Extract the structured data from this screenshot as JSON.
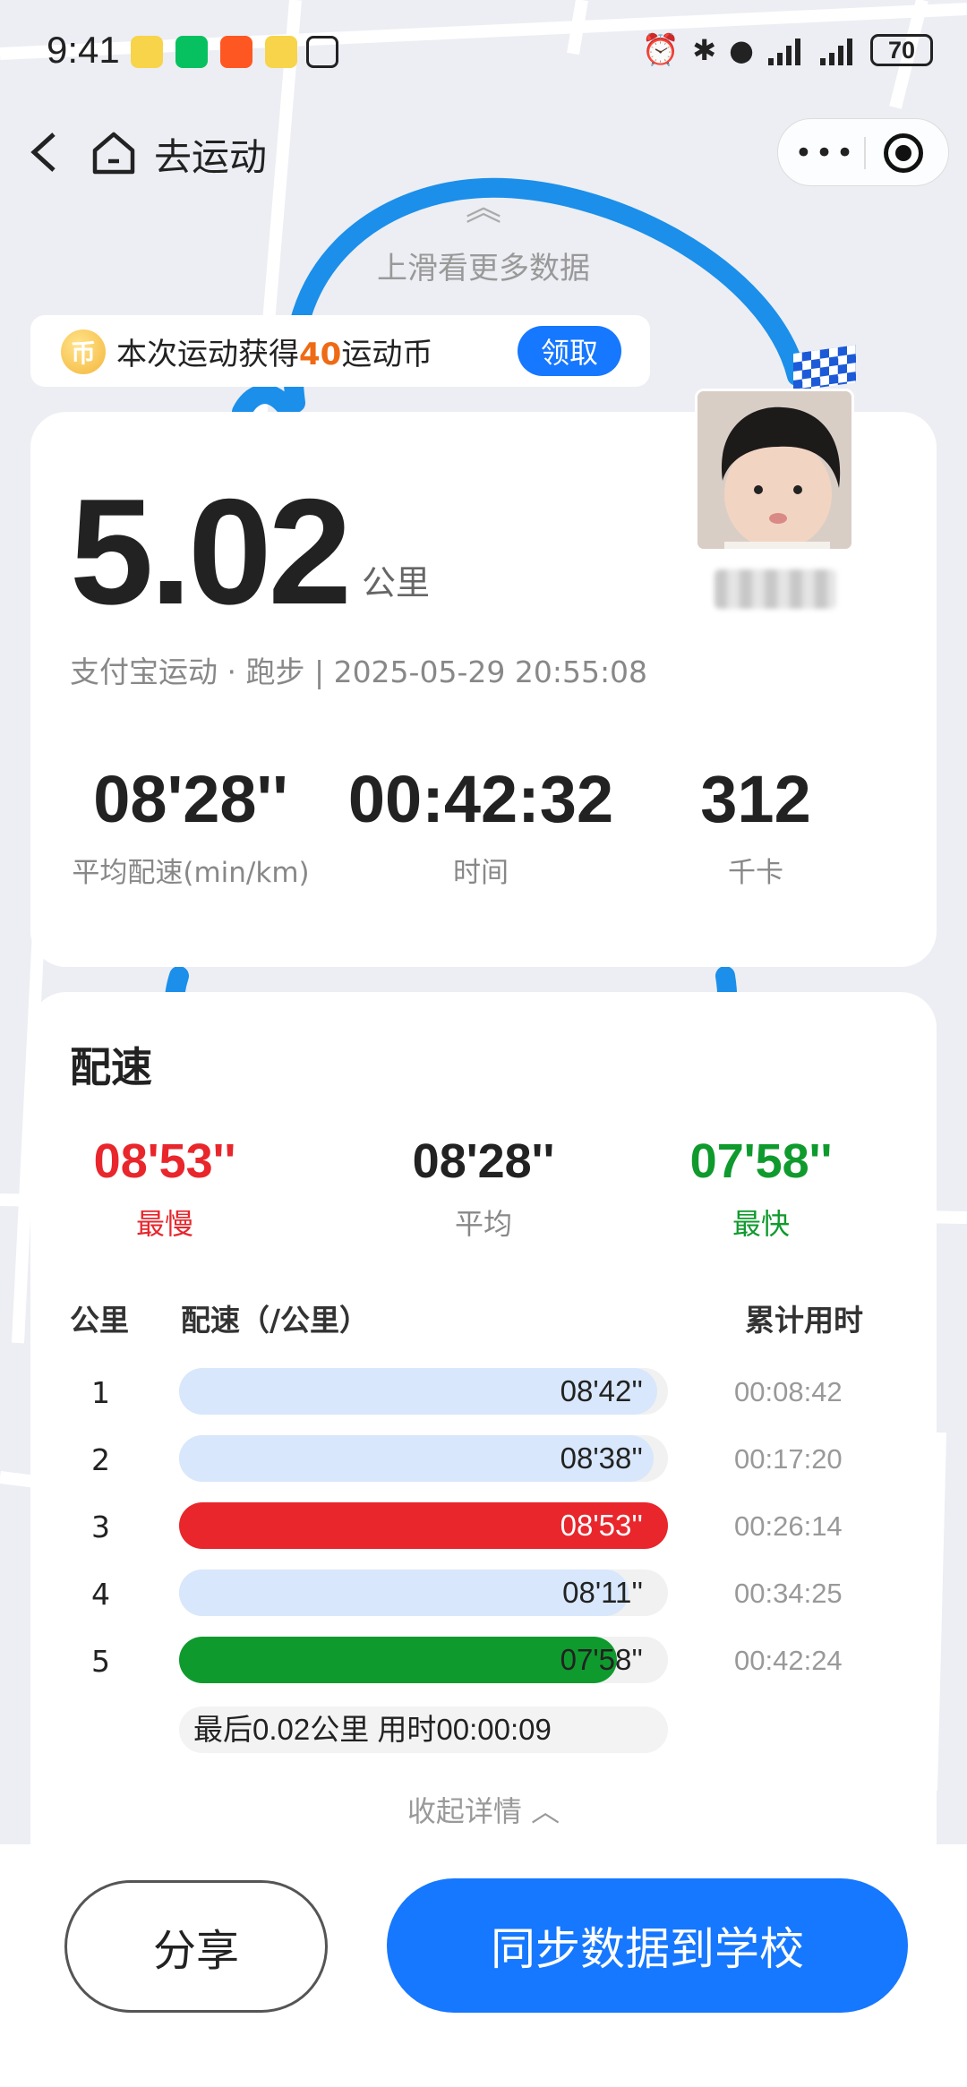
{
  "status_bar": {
    "time": "9:41",
    "battery": "70",
    "apps": [
      "weibo-icon",
      "wechat-icon",
      "taobao-icon",
      "weibo-icon",
      "nfc-icon"
    ],
    "right_icons": [
      "alarm-icon",
      "bluetooth-icon",
      "location-icon",
      "signal-icon",
      "signal-icon"
    ]
  },
  "nav": {
    "title": "去运动",
    "more": "•••"
  },
  "swipe_hint": {
    "chevron": "︽",
    "text": "上滑看更多数据"
  },
  "reward": {
    "prefix": "本次运动获得",
    "amount": "40",
    "suffix": "运动币",
    "claim_label": "领取",
    "coin_glyph": "币"
  },
  "summary": {
    "distance": "5.02",
    "distance_unit": "公里",
    "meta": "支付宝运动 · 跑步 | 2025-05-29 20:55:08",
    "stats": [
      {
        "value": "08'28''",
        "label": "平均配速(min/km)"
      },
      {
        "value": "00:42:32",
        "label": "时间"
      },
      {
        "value": "312",
        "label": "千卡"
      }
    ]
  },
  "pace": {
    "title": "配速",
    "slowest": {
      "value": "08'53''",
      "label": "最慢"
    },
    "average": {
      "value": "08'28''",
      "label": "平均"
    },
    "fastest": {
      "value": "07'58''",
      "label": "最快"
    },
    "headers": {
      "km": "公里",
      "pace": "配速（/公里）",
      "cumulative": "累计用时"
    },
    "splits": [
      {
        "km": "1",
        "pace": "08'42''",
        "cumulative": "00:08:42",
        "fraction": 0.978,
        "kind": "normal"
      },
      {
        "km": "2",
        "pace": "08'38''",
        "cumulative": "00:17:20",
        "fraction": 0.97,
        "kind": "normal"
      },
      {
        "km": "3",
        "pace": "08'53''",
        "cumulative": "00:26:14",
        "fraction": 1.0,
        "kind": "slowest"
      },
      {
        "km": "4",
        "pace": "08'11''",
        "cumulative": "00:34:25",
        "fraction": 0.92,
        "kind": "normal"
      },
      {
        "km": "5",
        "pace": "07'58''",
        "cumulative": "00:42:24",
        "fraction": 0.896,
        "kind": "fastest"
      }
    ],
    "last_segment": "最后0.02公里 用时00:00:09",
    "collapse_label": "收起详情 ︿"
  },
  "colors": {
    "slow": "#e8262c",
    "fast": "#0f9a2d",
    "normal_fill": "#d8e7fb",
    "accent": "#1677ff",
    "route": "#1b8fea"
  },
  "buttons": {
    "share": "分享",
    "sync": "同步数据到学校"
  }
}
